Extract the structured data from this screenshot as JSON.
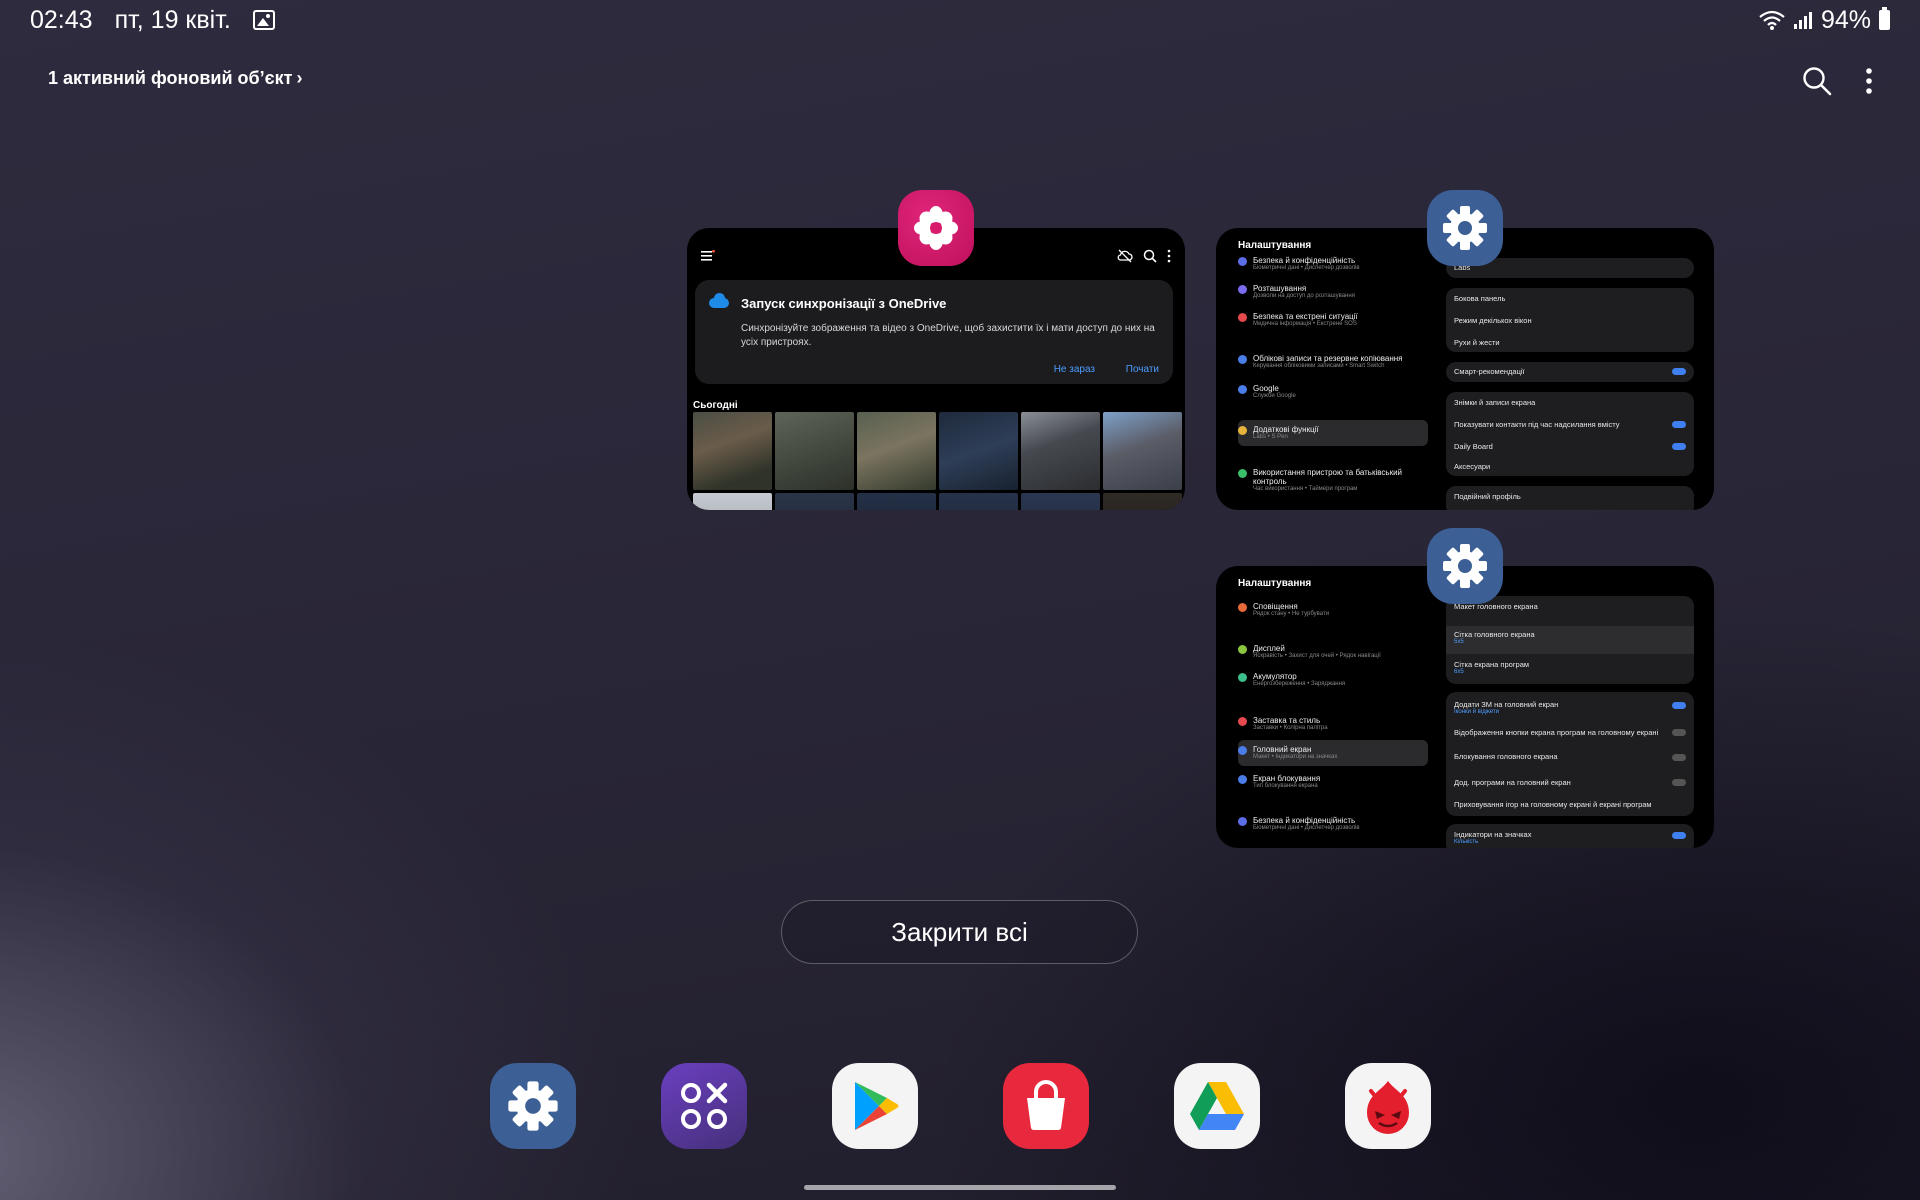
{
  "status_bar": {
    "time": "02:43",
    "date": "пт, 19 квіт.",
    "battery": "94%"
  },
  "header": {
    "background_link": "1 активний фоновий об’єкт",
    "chevron": "›"
  },
  "recent_apps": [
    {
      "app": "Gallery",
      "icon": "gallery-flower-icon",
      "banner_title": "Запуск синхронізації з OneDrive",
      "banner_text": "Синхронізуйте зображення та відео з OneDrive, щоб захистити їх і мати доступ до них на усіх пристроях.",
      "not_now": "Не зараз",
      "start": "Почати",
      "today": "Сьогодні"
    },
    {
      "app": "Settings",
      "icon": "gear-icon",
      "title": "Налаштування",
      "left_items": [
        {
          "label": "Безпека й конфіденційність",
          "sub": "Біометричні дані • Диспетчер дозволів"
        },
        {
          "label": "Розташування",
          "sub": "Дозволи на доступ до розташування"
        },
        {
          "label": "Безпека та екстрені ситуації",
          "sub": "Медична інформація • Екстрене SOS"
        },
        {
          "label": "Облікові записи та резервне копіювання",
          "sub": "Керування обліковими записами • Smart Switch"
        },
        {
          "label": "Google",
          "sub": "Служби Google"
        },
        {
          "label": "Додаткові функції",
          "sub": "Labs • S Pen"
        },
        {
          "label": "Використання пристрою та батьківський контроль",
          "sub": "Час використання • Таймери програм"
        }
      ],
      "right_items": [
        {
          "label": "Labs"
        },
        {
          "label": "Бокова панель"
        },
        {
          "label": "Режим декількох вікон"
        },
        {
          "label": "Рухи й жести"
        },
        {
          "label": "Смарт-рекомендації"
        },
        {
          "label": "Знімки й записи екрана"
        },
        {
          "label": "Показувати контакти під час надсилання вмісту"
        },
        {
          "label": "Daily Board"
        },
        {
          "label": "Аксесуари"
        },
        {
          "label": "Подвійний профіль"
        }
      ]
    },
    {
      "app": "Settings",
      "icon": "gear-icon",
      "title": "Налаштування",
      "left_items": [
        {
          "label": "Сповіщення",
          "sub": "Рядок стану • Не турбувати"
        },
        {
          "label": "Дисплей",
          "sub": "Яскравість • Захист для очей • Рядок навігації"
        },
        {
          "label": "Акумулятор",
          "sub": "Енергозбереження • Заряджання"
        },
        {
          "label": "Заставка та стиль",
          "sub": "Заставки • Колірна палітра"
        },
        {
          "label": "Головний екран",
          "sub": "Макет • Індикатори на значках"
        },
        {
          "label": "Екран блокування",
          "sub": "Тип блокування екрана"
        },
        {
          "label": "Безпека й конфіденційність",
          "sub": "Біометричні дані • Диспетчер дозволів"
        }
      ],
      "right_items": [
        {
          "label": "Макет головного екрана"
        },
        {
          "label": "Сітка головного екрана",
          "sub": "5x5"
        },
        {
          "label": "Сітка екрана програм",
          "sub": "6x5"
        },
        {
          "label": "Додати ЗМ на головний екран",
          "sub": "Іконки й віджети"
        },
        {
          "label": "Відображення кнопки екрана програм на головному екрані"
        },
        {
          "label": "Блокування головного екрана"
        },
        {
          "label": "Дод. програми на головний екран"
        },
        {
          "label": "Приховування ігор на головному екрані й екрані програм"
        },
        {
          "label": "Індикатори на значках",
          "sub": "Кількість"
        }
      ]
    }
  ],
  "close_all_label": "Закрити всі",
  "dock": [
    "settings-icon",
    "game-launcher-icon",
    "play-store-icon",
    "galaxy-store-icon",
    "google-drive-icon",
    "antutu-icon"
  ],
  "colors": {
    "accent_blue": "#3f7ff0",
    "gallery_pink": "#d81b6a",
    "settings_blue": "#3c5f95",
    "galaxy_store_red": "#e8283c"
  }
}
